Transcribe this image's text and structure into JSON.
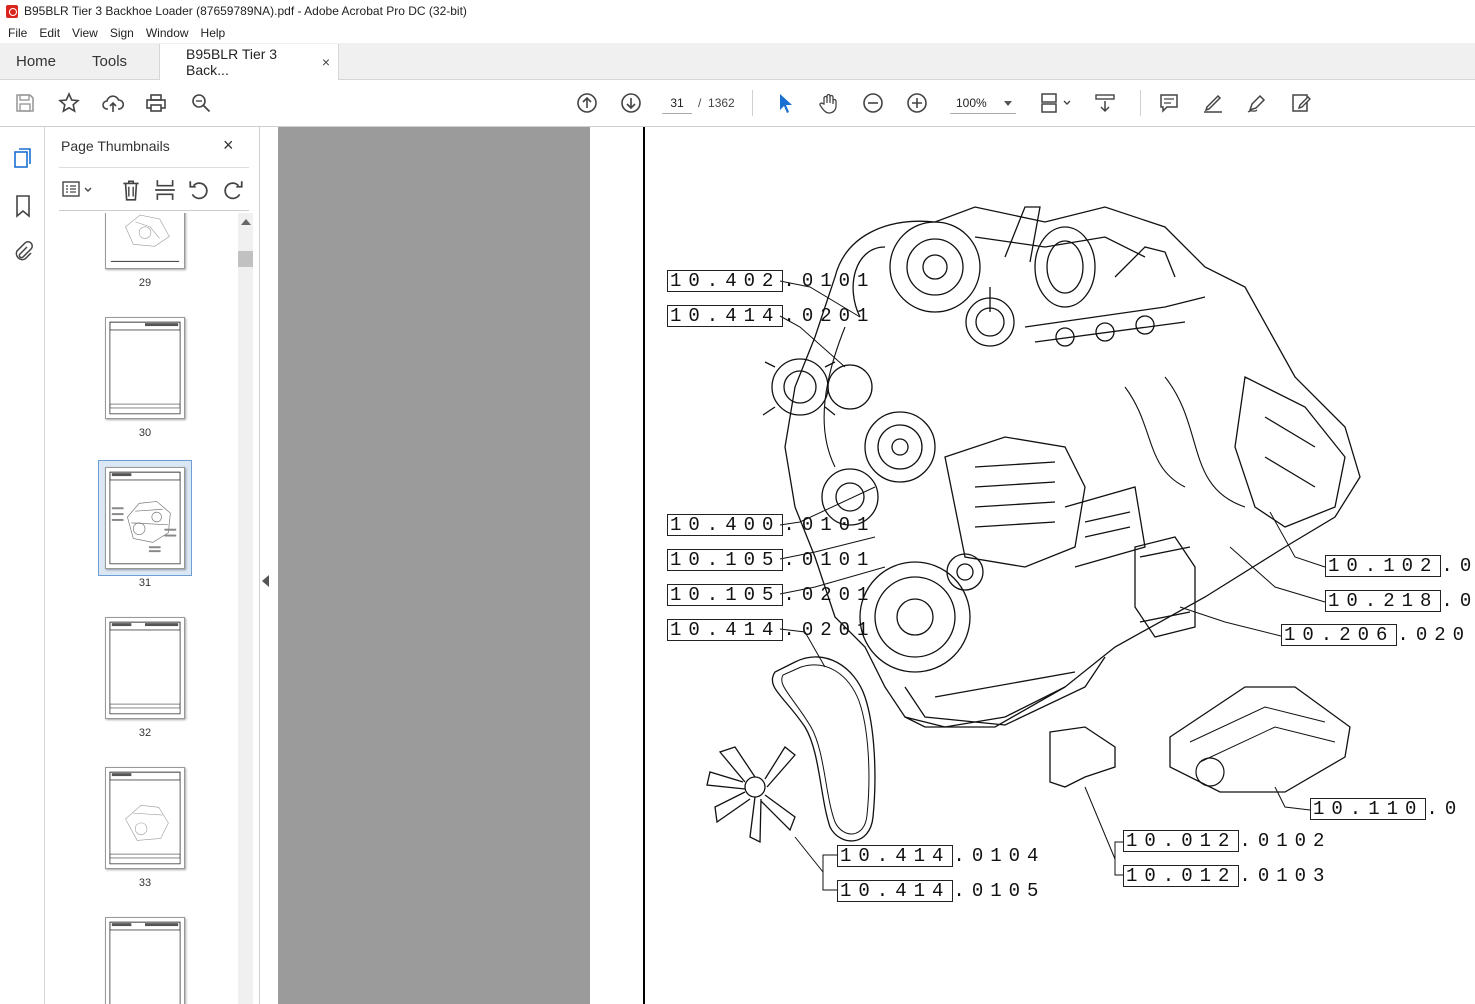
{
  "window": {
    "title": "B95BLR Tier 3 Backhoe Loader (87659789NA).pdf - Adobe Acrobat Pro DC (32-bit)"
  },
  "menu": [
    "File",
    "Edit",
    "View",
    "Sign",
    "Window",
    "Help"
  ],
  "tabs": {
    "home": "Home",
    "tools": "Tools",
    "document": "B95BLR Tier 3 Back...",
    "close": "×"
  },
  "toolbar": {
    "page_current": "31",
    "page_separator": "/",
    "page_total": "1362",
    "zoom": "100%"
  },
  "panel": {
    "title": "Page Thumbnails",
    "close": "×",
    "thumbnails": [
      {
        "label": "29"
      },
      {
        "label": "30"
      },
      {
        "label": "31",
        "selected": true
      },
      {
        "label": "32"
      },
      {
        "label": "33"
      }
    ]
  },
  "drawing": {
    "callouts": [
      {
        "code": "10.402",
        "suffix": ".0101"
      },
      {
        "code": "10.414",
        "suffix": ".0201"
      },
      {
        "code": "10.400",
        "suffix": ".0101"
      },
      {
        "code": "10.105",
        "suffix": ".0101"
      },
      {
        "code": "10.105",
        "suffix": ".0201"
      },
      {
        "code": "10.414",
        "suffix": ".0201"
      },
      {
        "code": "10.102",
        "suffix": ".0"
      },
      {
        "code": "10.218",
        "suffix": ".0"
      },
      {
        "code": "10.206",
        "suffix": ".020"
      },
      {
        "code": "10.110",
        "suffix": ".0"
      },
      {
        "code": "10.012",
        "suffix": ".0102"
      },
      {
        "code": "10.012",
        "suffix": ".0103"
      },
      {
        "code": "10.414",
        "suffix": ".0104"
      },
      {
        "code": "10.414",
        "suffix": ".0105"
      }
    ]
  }
}
